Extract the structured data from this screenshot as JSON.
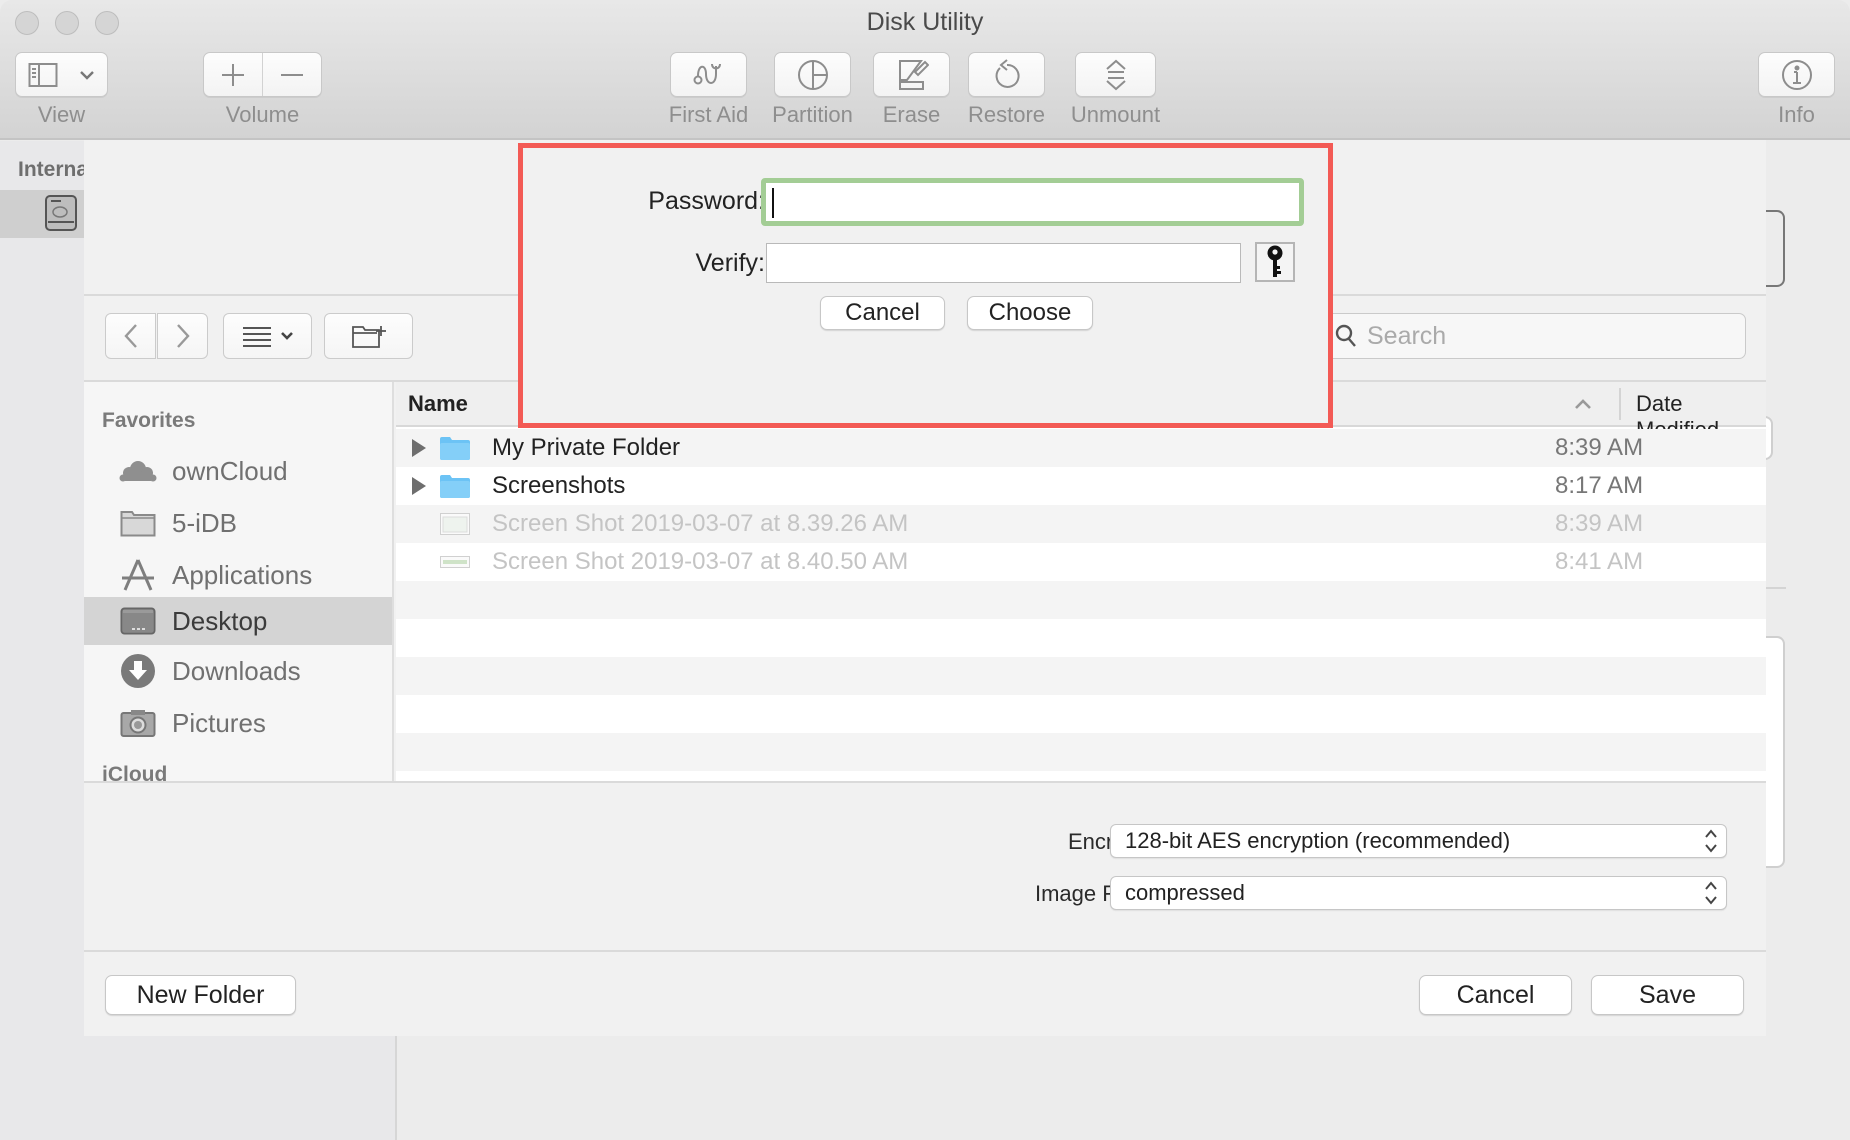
{
  "window": {
    "title": "Disk Utility"
  },
  "toolbar": {
    "view_label": "View",
    "volume_label": "Volume",
    "first_aid_label": "First Aid",
    "partition_label": "Partition",
    "erase_label": "Erase",
    "restore_label": "Restore",
    "unmount_label": "Unmount",
    "info_label": "Info"
  },
  "disk_utility_sidebar": {
    "section_label": "Internal"
  },
  "save_sheet": {
    "search_placeholder": "Search",
    "sidebar": {
      "favorites_header": "Favorites",
      "items": [
        {
          "label": "ownCloud",
          "icon": "owncloud-icon",
          "selected": false
        },
        {
          "label": "5-iDB",
          "icon": "folder-icon",
          "selected": false
        },
        {
          "label": "Applications",
          "icon": "applications-icon",
          "selected": false
        },
        {
          "label": "Desktop",
          "icon": "desktop-icon",
          "selected": true
        },
        {
          "label": "Downloads",
          "icon": "downloads-icon",
          "selected": false
        },
        {
          "label": "Pictures",
          "icon": "pictures-icon",
          "selected": false
        }
      ],
      "icloud_header": "iCloud"
    },
    "columns": {
      "name": "Name",
      "date_modified": "Date Modified",
      "sort_indicator": "ascending"
    },
    "files": [
      {
        "name": "My Private Folder",
        "date": "8:39 AM",
        "kind": "folder",
        "enabled": true
      },
      {
        "name": "Screenshots",
        "date": "8:17 AM",
        "kind": "folder",
        "enabled": true
      },
      {
        "name": "Screen Shot 2019-03-07 at 8.39.26 AM",
        "date": "8:39 AM",
        "kind": "image",
        "enabled": false
      },
      {
        "name": "Screen Shot 2019-03-07 at 8.40.50 AM",
        "date": "8:41 AM",
        "kind": "image",
        "enabled": false
      }
    ],
    "options": {
      "encryption_label": "Encryption:",
      "encryption_value": "128-bit AES encryption (recommended)",
      "image_format_label": "Image Format:",
      "image_format_value": "compressed"
    },
    "buttons": {
      "new_folder": "New Folder",
      "cancel": "Cancel",
      "save": "Save"
    }
  },
  "password_dialog": {
    "password_label": "Password:",
    "password_value": "",
    "verify_label": "Verify:",
    "verify_value": "",
    "cancel": "Cancel",
    "choose": "Choose",
    "highlight_color": "#f35a55",
    "focus_ring_color": "#a3cd95"
  }
}
